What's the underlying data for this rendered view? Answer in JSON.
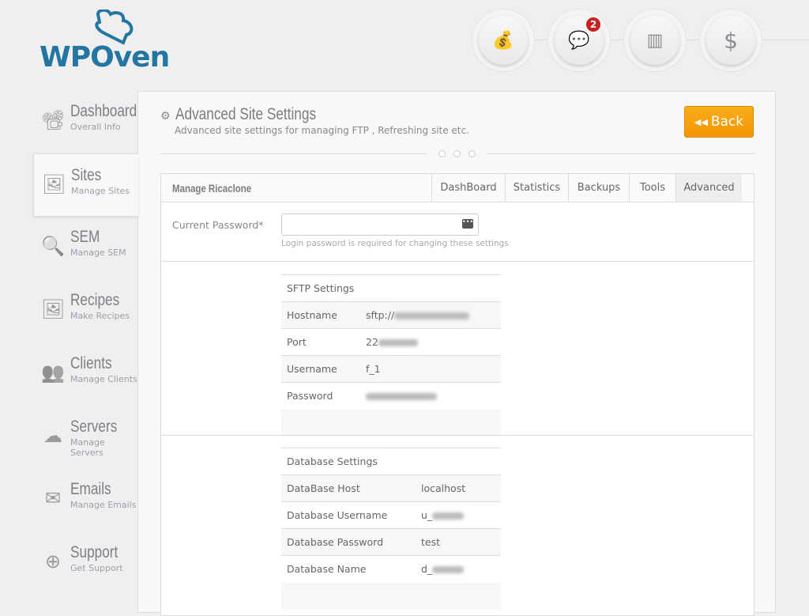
{
  "brand": {
    "name": "WPOven"
  },
  "topnav": [
    {
      "icon": "coins-icon"
    },
    {
      "icon": "chat-icon",
      "badge": "2"
    },
    {
      "icon": "layout-icon"
    },
    {
      "icon": "dollar-icon"
    }
  ],
  "sidebar": [
    {
      "title": "Dashboard",
      "sub": "Overall Info",
      "icon": "presentation-icon"
    },
    {
      "title": "Sites",
      "sub": "Manage Sites",
      "icon": "image-icon"
    },
    {
      "title": "SEM",
      "sub": "Manage SEM",
      "icon": "search-icon"
    },
    {
      "title": "Recipes",
      "sub": "Make Recipes",
      "icon": "picture-icon"
    },
    {
      "title": "Clients",
      "sub": "Manage Clients",
      "icon": "users-icon"
    },
    {
      "title": "Servers",
      "sub": "Manage Servers",
      "icon": "cloud-icon"
    },
    {
      "title": "Emails",
      "sub": "Manage Emails",
      "icon": "envelope-icon"
    },
    {
      "title": "Support",
      "sub": "Get Support",
      "icon": "lifebuoy-icon"
    }
  ],
  "page": {
    "title": "Advanced Site Settings",
    "subtitle": "Advanced site settings for managing FTP , Refreshing site etc.",
    "back": "Back"
  },
  "box": {
    "title": "Manage Ricaclone",
    "tabs": [
      "DashBoard",
      "Statistics",
      "Backups",
      "Tools",
      "Advanced"
    ],
    "active_tab": "Advanced"
  },
  "password": {
    "label": "Current Password*",
    "value": "",
    "hint": "Login password is required for changing these settings"
  },
  "sftp": {
    "heading": "SFTP Settings",
    "rows": [
      [
        "Hostname",
        "sftp://"
      ],
      [
        "Port",
        "22"
      ],
      [
        "Username",
        "f_1"
      ],
      [
        "Password",
        ""
      ]
    ]
  },
  "db": {
    "heading": "Database Settings",
    "rows": [
      [
        "DataBase Host",
        "localhost"
      ],
      [
        "Database Username",
        "u_"
      ],
      [
        "Database Password",
        "test"
      ],
      [
        "Database Name",
        "d_"
      ]
    ]
  }
}
